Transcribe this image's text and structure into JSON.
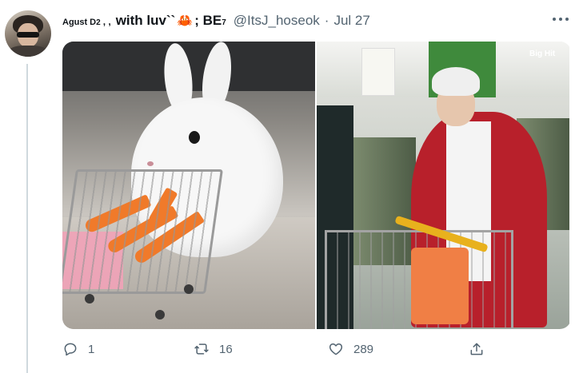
{
  "tweet": {
    "display_name": {
      "prefix": "Agust",
      "d": "D",
      "sup": "2",
      "dots": ", ,",
      "main": "with luv``",
      "crab": "🦀",
      "after": "; BE",
      "after_sup": "7"
    },
    "handle": "@ItsJ_hoseok",
    "separator": "·",
    "date": "Jul 27",
    "more_icon": "more-horizontal-icon"
  },
  "media": {
    "watermark_text": "Big Hit"
  },
  "actions": {
    "reply_count": "1",
    "retweet_count": "16",
    "like_count": "289",
    "icons": [
      "reply-icon",
      "retweet-icon",
      "like-icon",
      "share-icon"
    ]
  },
  "colors": {
    "secondary_text": "#536471",
    "thread_line": "#cfd9de"
  }
}
